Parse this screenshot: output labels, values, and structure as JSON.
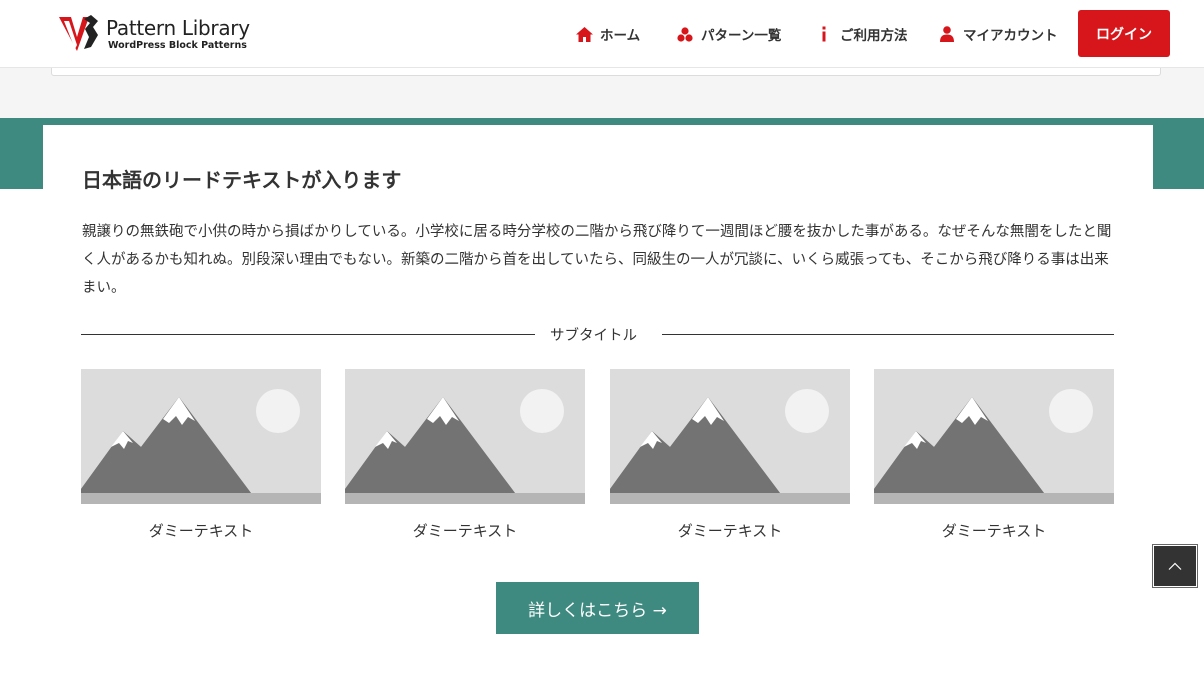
{
  "header": {
    "logo": {
      "title": "Pattern Library",
      "subtitle": "WordPress Block Patterns",
      "mark_color": "#d7161c"
    },
    "nav": [
      {
        "label": "ホーム",
        "icon": "home-icon"
      },
      {
        "label": "パターン一覧",
        "icon": "patterns-icon"
      },
      {
        "label": "ご利用方法",
        "icon": "info-icon"
      },
      {
        "label": "マイアカウント",
        "icon": "user-icon"
      }
    ],
    "login_label": "ログイン"
  },
  "main": {
    "lead_title": "日本語のリードテキストが入ります",
    "lead_text": "親譲りの無鉄砲で小供の時から損ばかりしている。小学校に居る時分学校の二階から飛び降りて一週間ほど腰を抜かした事がある。なぜそんな無闇をしたと聞く人があるかも知れぬ。別段深い理由でもない。新築の二階から首を出していたら、同級生の一人が冗談に、いくら威張っても、そこから飛び降りる事は出来まい。",
    "subtitle": "サブタイトル",
    "cards": [
      {
        "caption": "ダミーテキスト",
        "image": "sample-image-mountains"
      },
      {
        "caption": "ダミーテキスト",
        "image": "sample-image-mountains"
      },
      {
        "caption": "ダミーテキスト",
        "image": "sample-image-mountains"
      },
      {
        "caption": "ダミーテキスト",
        "image": "sample-image-mountains"
      }
    ],
    "more_button": "詳しくはこちら →"
  },
  "colors": {
    "accent_red": "#d7161c",
    "teal": "#3e8a80",
    "text": "#333333"
  },
  "back_to_top_icon": "chevron-up-icon"
}
